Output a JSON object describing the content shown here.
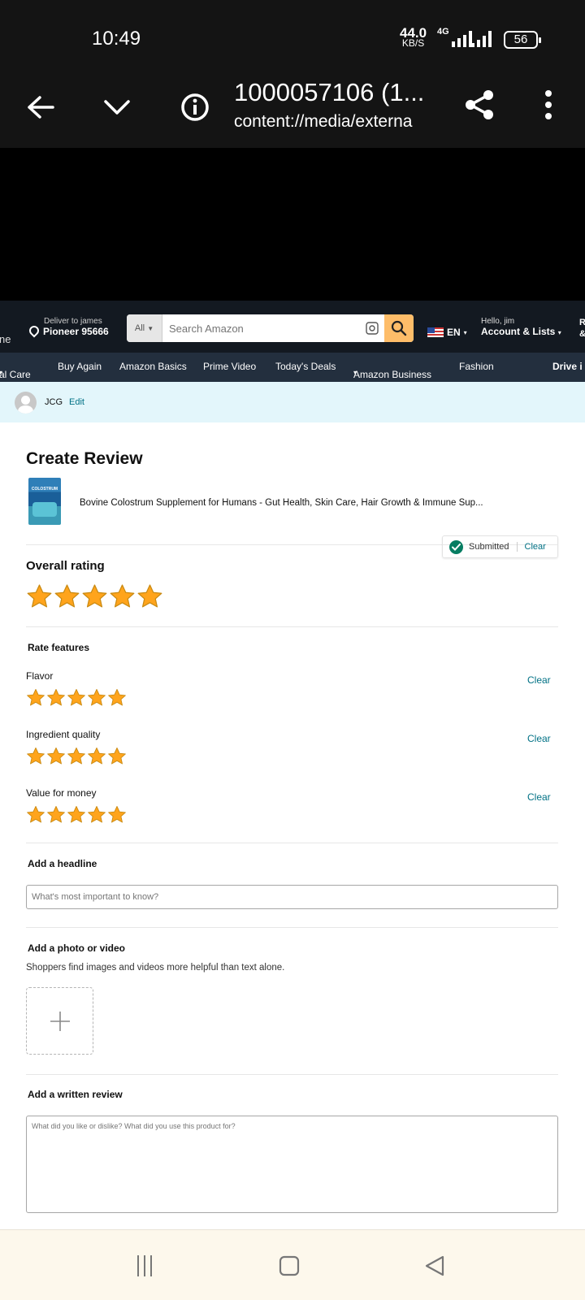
{
  "status_bar": {
    "time": "10:49",
    "net_speed": "44.0",
    "net_speed_unit": "KB/S",
    "network_type": "4G",
    "battery": "56"
  },
  "viewer": {
    "title": "1000057106 (1...",
    "subtitle": "content://media/externa"
  },
  "amazon": {
    "edge_left": "ne",
    "deliver_line1": "Deliver to james",
    "deliver_line2": "Pioneer 95666",
    "search_category": "All",
    "search_placeholder": "Search Amazon",
    "language": "EN",
    "greeting": "Hello, jim",
    "account_label": "Account & Lists",
    "edge_right": "R &",
    "nav_items": [
      "al Care",
      "Buy Again",
      "Amazon Basics",
      "Prime Video",
      "Today's Deals",
      "Amazon Business",
      "Fashion",
      "Drive i"
    ],
    "user_name": "JCG",
    "user_edit": "Edit"
  },
  "review": {
    "page_title": "Create Review",
    "product_title": "Bovine Colostrum Supplement for Humans - Gut Health, Skin Care, Hair Growth & Immune Sup...",
    "status_text": "Submitted",
    "status_clear": "Clear",
    "overall_label": "Overall rating",
    "overall_stars": 5,
    "rate_features_label": "Rate features",
    "features": [
      {
        "label": "Flavor",
        "stars": 5,
        "clear": "Clear"
      },
      {
        "label": "Ingredient quality",
        "stars": 5,
        "clear": "Clear"
      },
      {
        "label": "Value for money",
        "stars": 5,
        "clear": "Clear"
      }
    ],
    "headline_label": "Add a headline",
    "headline_placeholder": "What's most important to know?",
    "photo_label": "Add a photo or video",
    "photo_hint": "Shoppers find images and videos more helpful than text alone.",
    "written_label": "Add a written review",
    "written_placeholder": "What did you like or dislike? What did you use this product for?"
  },
  "colors": {
    "amazon_nav": "#131921",
    "amazon_subnav": "#232f3e",
    "link": "#007185",
    "star": "#ffa41c",
    "search_button": "#febd69"
  }
}
